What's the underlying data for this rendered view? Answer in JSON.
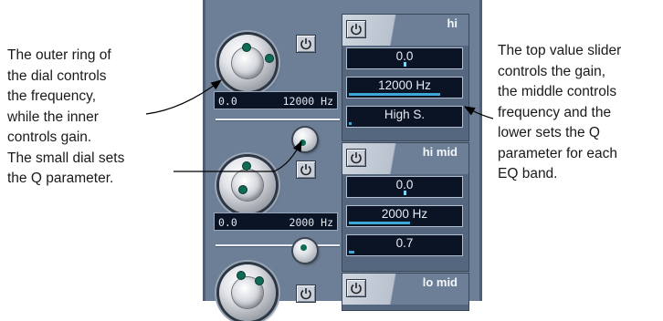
{
  "annotations": {
    "left": [
      "The outer ring of",
      "the dial controls",
      "the frequency,",
      "while the inner",
      "controls gain.",
      "The small dial sets",
      "the Q parameter."
    ],
    "right": [
      "The top value slider",
      "controls the gain,",
      "the middle controls",
      "frequency and the",
      "lower sets the Q",
      "parameter for each",
      "EQ band."
    ]
  },
  "knob_readouts": [
    {
      "gain": "0.0",
      "freq": "12000 Hz"
    },
    {
      "gain": "0.0",
      "freq": "2000 Hz"
    }
  ],
  "bands": [
    {
      "name": "hi",
      "gain": "0.0",
      "gain_level": 0.5,
      "freq": "12000 Hz",
      "freq_level": 0.82,
      "q": "High S.",
      "q_level": 0.02
    },
    {
      "name": "hi mid",
      "gain": "0.0",
      "gain_level": 0.5,
      "freq": "2000 Hz",
      "freq_level": 0.55,
      "q": "0.7",
      "q_level": 0.05
    },
    {
      "name": "lo mid"
    }
  ],
  "icons": {
    "power": "power-icon"
  },
  "colors": {
    "panel": "#6d7f97",
    "display": "#0b1424",
    "accent": "#3fa7d6",
    "knob_dot": "#0f6b55"
  }
}
